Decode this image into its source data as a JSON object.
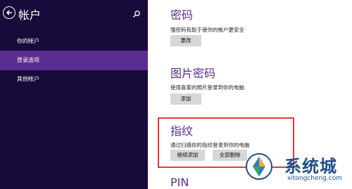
{
  "sidebar": {
    "title": "帐户",
    "items": [
      {
        "label": "你的帐户",
        "active": false
      },
      {
        "label": "登录选项",
        "active": true
      },
      {
        "label": "其他帐户",
        "active": false
      }
    ]
  },
  "main": {
    "password": {
      "title": "密码",
      "desc": "强密码有助于使你的帐户更安全",
      "button": "更改"
    },
    "picture_password": {
      "title": "图片密码",
      "desc": "使用喜爱的照片登录到你的电脑",
      "button": "添加"
    },
    "fingerprint": {
      "title": "指纹",
      "desc": "通过扫描你的指纹登录到你的电脑",
      "button_add": "继续添加",
      "button_remove": "全部删除"
    },
    "pin": {
      "title": "PIN"
    }
  },
  "watermark": {
    "text": "系统城",
    "url": "xitongcheng.com"
  },
  "colors": {
    "sidebar_bg": "#180a3a",
    "active_item": "#5c2d91",
    "accent": "#5c2d91",
    "highlight_box": "#e53935"
  }
}
